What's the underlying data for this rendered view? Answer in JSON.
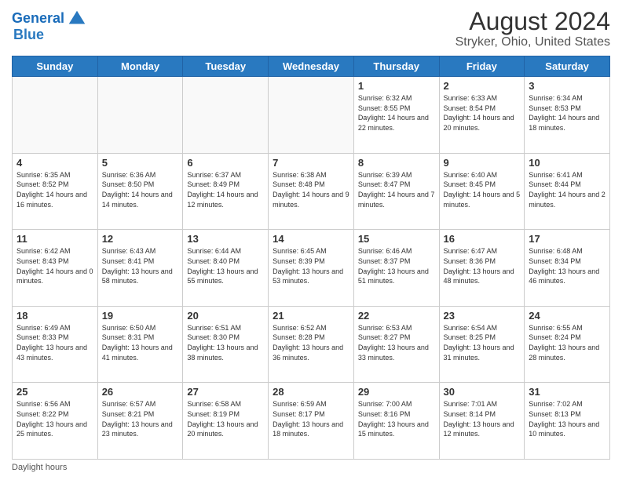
{
  "header": {
    "logo_line1": "General",
    "logo_line2": "Blue",
    "title": "August 2024",
    "subtitle": "Stryker, Ohio, United States"
  },
  "weekdays": [
    "Sunday",
    "Monday",
    "Tuesday",
    "Wednesday",
    "Thursday",
    "Friday",
    "Saturday"
  ],
  "weeks": [
    [
      {
        "day": "",
        "info": ""
      },
      {
        "day": "",
        "info": ""
      },
      {
        "day": "",
        "info": ""
      },
      {
        "day": "",
        "info": ""
      },
      {
        "day": "1",
        "info": "Sunrise: 6:32 AM\nSunset: 8:55 PM\nDaylight: 14 hours and 22 minutes."
      },
      {
        "day": "2",
        "info": "Sunrise: 6:33 AM\nSunset: 8:54 PM\nDaylight: 14 hours and 20 minutes."
      },
      {
        "day": "3",
        "info": "Sunrise: 6:34 AM\nSunset: 8:53 PM\nDaylight: 14 hours and 18 minutes."
      }
    ],
    [
      {
        "day": "4",
        "info": "Sunrise: 6:35 AM\nSunset: 8:52 PM\nDaylight: 14 hours and 16 minutes."
      },
      {
        "day": "5",
        "info": "Sunrise: 6:36 AM\nSunset: 8:50 PM\nDaylight: 14 hours and 14 minutes."
      },
      {
        "day": "6",
        "info": "Sunrise: 6:37 AM\nSunset: 8:49 PM\nDaylight: 14 hours and 12 minutes."
      },
      {
        "day": "7",
        "info": "Sunrise: 6:38 AM\nSunset: 8:48 PM\nDaylight: 14 hours and 9 minutes."
      },
      {
        "day": "8",
        "info": "Sunrise: 6:39 AM\nSunset: 8:47 PM\nDaylight: 14 hours and 7 minutes."
      },
      {
        "day": "9",
        "info": "Sunrise: 6:40 AM\nSunset: 8:45 PM\nDaylight: 14 hours and 5 minutes."
      },
      {
        "day": "10",
        "info": "Sunrise: 6:41 AM\nSunset: 8:44 PM\nDaylight: 14 hours and 2 minutes."
      }
    ],
    [
      {
        "day": "11",
        "info": "Sunrise: 6:42 AM\nSunset: 8:43 PM\nDaylight: 14 hours and 0 minutes."
      },
      {
        "day": "12",
        "info": "Sunrise: 6:43 AM\nSunset: 8:41 PM\nDaylight: 13 hours and 58 minutes."
      },
      {
        "day": "13",
        "info": "Sunrise: 6:44 AM\nSunset: 8:40 PM\nDaylight: 13 hours and 55 minutes."
      },
      {
        "day": "14",
        "info": "Sunrise: 6:45 AM\nSunset: 8:39 PM\nDaylight: 13 hours and 53 minutes."
      },
      {
        "day": "15",
        "info": "Sunrise: 6:46 AM\nSunset: 8:37 PM\nDaylight: 13 hours and 51 minutes."
      },
      {
        "day": "16",
        "info": "Sunrise: 6:47 AM\nSunset: 8:36 PM\nDaylight: 13 hours and 48 minutes."
      },
      {
        "day": "17",
        "info": "Sunrise: 6:48 AM\nSunset: 8:34 PM\nDaylight: 13 hours and 46 minutes."
      }
    ],
    [
      {
        "day": "18",
        "info": "Sunrise: 6:49 AM\nSunset: 8:33 PM\nDaylight: 13 hours and 43 minutes."
      },
      {
        "day": "19",
        "info": "Sunrise: 6:50 AM\nSunset: 8:31 PM\nDaylight: 13 hours and 41 minutes."
      },
      {
        "day": "20",
        "info": "Sunrise: 6:51 AM\nSunset: 8:30 PM\nDaylight: 13 hours and 38 minutes."
      },
      {
        "day": "21",
        "info": "Sunrise: 6:52 AM\nSunset: 8:28 PM\nDaylight: 13 hours and 36 minutes."
      },
      {
        "day": "22",
        "info": "Sunrise: 6:53 AM\nSunset: 8:27 PM\nDaylight: 13 hours and 33 minutes."
      },
      {
        "day": "23",
        "info": "Sunrise: 6:54 AM\nSunset: 8:25 PM\nDaylight: 13 hours and 31 minutes."
      },
      {
        "day": "24",
        "info": "Sunrise: 6:55 AM\nSunset: 8:24 PM\nDaylight: 13 hours and 28 minutes."
      }
    ],
    [
      {
        "day": "25",
        "info": "Sunrise: 6:56 AM\nSunset: 8:22 PM\nDaylight: 13 hours and 25 minutes."
      },
      {
        "day": "26",
        "info": "Sunrise: 6:57 AM\nSunset: 8:21 PM\nDaylight: 13 hours and 23 minutes."
      },
      {
        "day": "27",
        "info": "Sunrise: 6:58 AM\nSunset: 8:19 PM\nDaylight: 13 hours and 20 minutes."
      },
      {
        "day": "28",
        "info": "Sunrise: 6:59 AM\nSunset: 8:17 PM\nDaylight: 13 hours and 18 minutes."
      },
      {
        "day": "29",
        "info": "Sunrise: 7:00 AM\nSunset: 8:16 PM\nDaylight: 13 hours and 15 minutes."
      },
      {
        "day": "30",
        "info": "Sunrise: 7:01 AM\nSunset: 8:14 PM\nDaylight: 13 hours and 12 minutes."
      },
      {
        "day": "31",
        "info": "Sunrise: 7:02 AM\nSunset: 8:13 PM\nDaylight: 13 hours and 10 minutes."
      }
    ]
  ],
  "footer": {
    "daylight_label": "Daylight hours"
  }
}
